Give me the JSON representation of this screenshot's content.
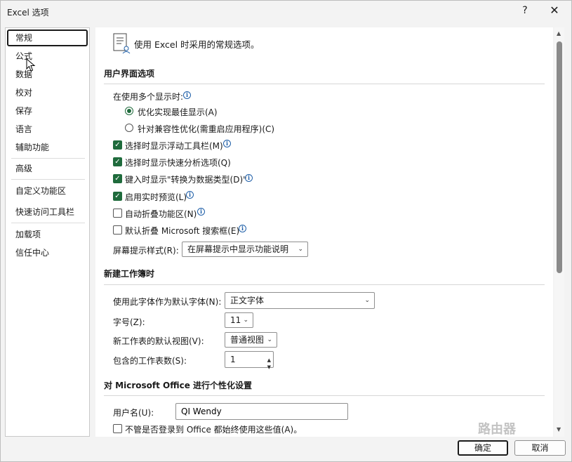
{
  "window": {
    "title": "Excel 选项",
    "help_glyph": "?",
    "close_glyph": "✕"
  },
  "nav": {
    "items": [
      {
        "label": "常规",
        "selected": true
      },
      {
        "label": "公式"
      },
      {
        "label": "数据"
      },
      {
        "label": "校对"
      },
      {
        "label": "保存"
      },
      {
        "label": "语言"
      },
      {
        "label": "辅助功能"
      },
      {
        "label": "高级"
      },
      {
        "label": "自定义功能区"
      },
      {
        "label": "快速访问工具栏"
      },
      {
        "label": "加载项"
      },
      {
        "label": "信任中心"
      }
    ]
  },
  "header": {
    "text": "使用 Excel 时采用的常规选项。"
  },
  "ui_section": {
    "title": "用户界面选项",
    "multi_display_label": "在使用多个显示时:",
    "radio_optimize": "优化实现最佳显示(A)",
    "radio_compat": "针对兼容性优化(需重启应用程序)(C)",
    "opt_mini_toolbar": "选择时显示浮动工具栏(M)",
    "opt_quick_analysis": "选择时显示快速分析选项(Q)",
    "opt_convert_type": "键入时显示\"转换为数据类型(D)\"",
    "opt_live_preview": "启用实时预览(L)",
    "opt_collapse_ribbon": "自动折叠功能区(N)",
    "opt_collapse_search": "默认折叠 Microsoft 搜索框(E)",
    "screentip_label": "屏幕提示样式(R):",
    "screentip_value": "在屏幕提示中显示功能说明"
  },
  "new_wb_section": {
    "title": "新建工作簿时",
    "font_label": "使用此字体作为默认字体(N):",
    "font_value": "正文字体",
    "size_label": "字号(Z):",
    "size_value": "11",
    "view_label": "新工作表的默认视图(V):",
    "view_value": "普通视图",
    "sheets_label": "包含的工作表数(S):",
    "sheets_value": "1"
  },
  "personalize_section": {
    "title": "对 Microsoft Office 进行个性化设置",
    "username_label": "用户名(U):",
    "username_value": "QI Wendy",
    "always_use_label": "不管是否登录到 Office 都始终使用这些值(A)。"
  },
  "buttons": {
    "ok": "确定",
    "cancel": "取消"
  },
  "watermark": "路由器",
  "colors": {
    "accent_green": "#1f6b3c",
    "info_blue": "#1f5fa8"
  }
}
